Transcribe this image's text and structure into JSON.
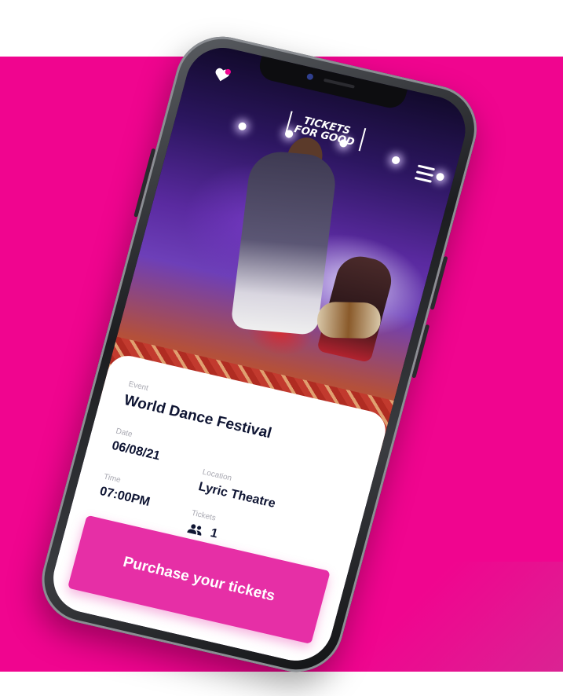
{
  "brand": {
    "logo_line1": "TICKETS",
    "logo_line2": "FOR GOOD",
    "logo_icon": "heart-icon",
    "menu_icon": "hamburger-icon"
  },
  "event": {
    "event_label": "Event",
    "event_name": "World Dance Festival",
    "date_label": "Date",
    "date_value": "06/08/21",
    "location_label": "Location",
    "location_value": "Lyric Theatre",
    "time_label": "Time",
    "time_value": "07:00PM",
    "tickets_label": "Tickets",
    "tickets_icon": "people-icon",
    "tickets_value": "1"
  },
  "purchase": {
    "button_label": "Purchase your tickets"
  },
  "colors": {
    "background_magenta": "#f0058f",
    "button_pink": "#e62fa6",
    "text_navy": "#0f1533",
    "label_gray": "#a9a9b2"
  }
}
